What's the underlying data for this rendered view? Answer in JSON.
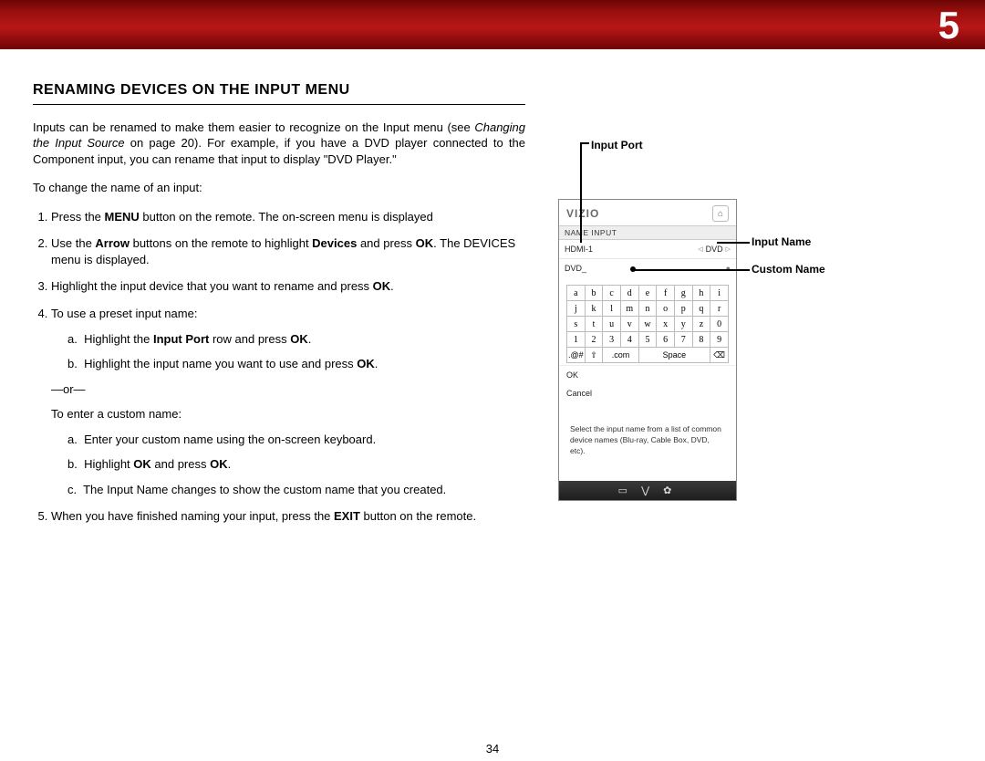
{
  "page": {
    "chapterNumber": "5",
    "footerPage": "34"
  },
  "heading": "RENAMING DEVICES ON THE INPUT MENU",
  "paragraphs": {
    "intro_a": "Inputs can be renamed to make them easier to recognize on the Input menu (see ",
    "intro_em": "Changing the Input Source",
    "intro_b": " on page 20). For example, if you have a DVD player connected to the Component input, you can rename that input to display \"DVD Player.\"",
    "lead": "To change the name of an input:"
  },
  "steps": {
    "s1a": "Press the ",
    "s1b": "MENU",
    "s1c": " button on the remote. The on-screen menu is displayed",
    "s2a": "Use the ",
    "s2b": "Arrow",
    "s2c": " buttons on the remote to highlight ",
    "s2d": "Devices",
    "s2e": " and press ",
    "s2f": "OK",
    "s2g": ". The DEVICES menu is displayed.",
    "s3a": "Highlight the input device that you want to rename and press ",
    "s3b": "OK",
    "s3c": ".",
    "s4": "To use a preset input name:",
    "s4a1": "Highlight the ",
    "s4a2": "Input Port",
    "s4a3": " row and press ",
    "s4a4": "OK",
    "s4a5": ".",
    "s4b1": "Highlight the input name you want to use and press ",
    "s4b2": "OK",
    "s4b3": ".",
    "or": "—or—",
    "s4c": "To enter a custom name:",
    "s4c_a": "Enter your custom name using the on-screen keyboard.",
    "s4c_b1": "Highlight ",
    "s4c_b2": "OK",
    "s4c_b3": " and press ",
    "s4c_b4": "OK",
    "s4c_b5": ".",
    "s4c_c": "The Input Name changes to show the custom name that you created.",
    "s5a": "When you have finished naming your input, press the ",
    "s5b": "EXIT",
    "s5c": " button on the remote."
  },
  "callouts": {
    "port": "Input Port",
    "name": "Input Name",
    "custom": "Custom Name"
  },
  "osd": {
    "brand": "VIZIO",
    "screenLabel": "NAME INPUT",
    "portRow": {
      "left": "HDMI-1",
      "right": "DVD"
    },
    "customRow": "DVD_",
    "keyboard": {
      "r1": [
        "a",
        "b",
        "c",
        "d",
        "e",
        "f",
        "g",
        "h",
        "i"
      ],
      "r2": [
        "j",
        "k",
        "l",
        "m",
        "n",
        "o",
        "p",
        "q",
        "r"
      ],
      "r3": [
        "s",
        "t",
        "u",
        "v",
        "w",
        "x",
        "y",
        "z",
        "0"
      ],
      "r4": [
        "1",
        "2",
        "3",
        "4",
        "5",
        "6",
        "7",
        "8",
        "9"
      ],
      "bottom": [
        ".@#",
        "⇧",
        ".com",
        "Space",
        "⌫"
      ]
    },
    "ok": "OK",
    "cancel": "Cancel",
    "hint": "Select the input name from a list of common device names (Blu-ray, Cable Box, DVD, etc).",
    "navIcons": "▭  ⋁  ✿"
  }
}
